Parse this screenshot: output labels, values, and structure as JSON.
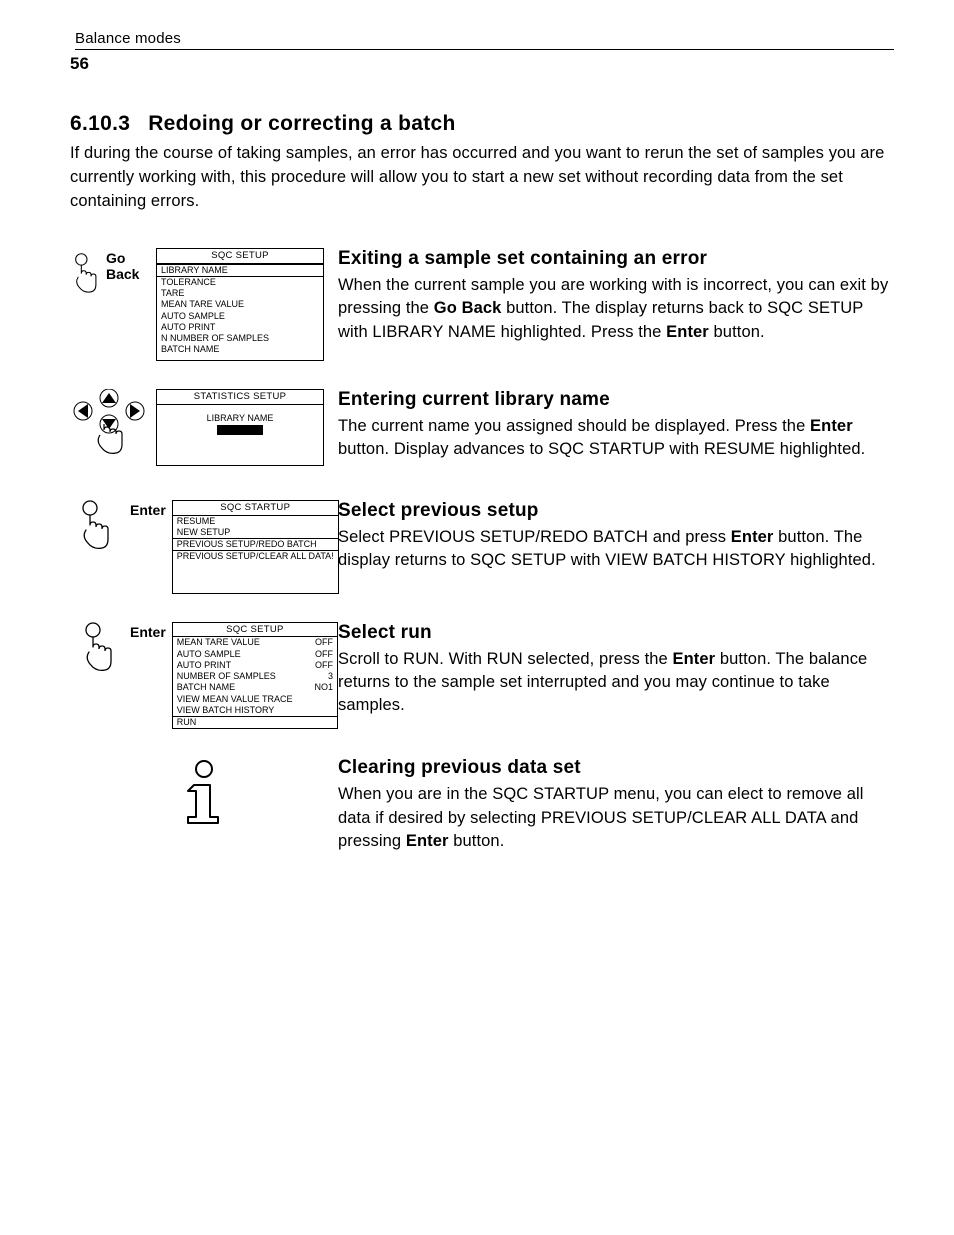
{
  "header": {
    "running": "Balance modes",
    "page_num": "56"
  },
  "section": {
    "number": "6.10.3",
    "title": "Redoing or correcting a batch",
    "intro": "If during the course of taking samples, an error has occurred and you want to rerun the set of samples you are currently working with, this procedure will allow you to start a new set without recording data from the set containing errors."
  },
  "steps": {
    "s1": {
      "button": "Go Back",
      "lcd_title": "SQC SETUP",
      "lcd_items": [
        "LIBRARY NAME",
        "TOLERANCE",
        "TARE",
        "MEAN TARE VALUE",
        "AUTO SAMPLE",
        "AUTO PRINT",
        "N NUMBER OF SAMPLES",
        "BATCH NAME"
      ],
      "heading": "Exiting a sample set containing an error",
      "body_a": "When the current sample you are working with is incorrect, you can exit by pressing the ",
      "body_b": " button. The display returns back to SQC SETUP with LIBRARY NAME highlighted. Press the ",
      "body_c": " button.",
      "bold1": "Go Back",
      "bold2": "Enter"
    },
    "s2": {
      "lcd_title": "STATISTICS SETUP",
      "lcd_field": "LIBRARY NAME",
      "heading": "Entering current library name",
      "body_a": "The current name you assigned should be displayed. Press the ",
      "body_b": " button. Display advances to SQC STARTUP with RESUME highlighted.",
      "bold1": "Enter"
    },
    "s3": {
      "button": "Enter",
      "lcd_title": "SQC STARTUP",
      "lcd_items": [
        "RESUME",
        "NEW SETUP",
        "PREVIOUS SETUP/REDO BATCH",
        "PREVIOUS SETUP/CLEAR ALL DATA!"
      ],
      "heading": "Select previous setup",
      "body_a": "Select PREVIOUS SETUP/REDO BATCH and press ",
      "body_b": " button. The display returns to SQC SETUP with VIEW BATCH HISTORY highlighted.",
      "bold1": "Enter"
    },
    "s4": {
      "button": "Enter",
      "lcd_title": "SQC SETUP",
      "lcd_rows": [
        {
          "k": "MEAN TARE VALUE",
          "v": "OFF"
        },
        {
          "k": "AUTO SAMPLE",
          "v": "OFF"
        },
        {
          "k": "AUTO PRINT",
          "v": "OFF"
        },
        {
          "k": "NUMBER OF SAMPLES",
          "v": "3"
        },
        {
          "k": "BATCH NAME",
          "v": "NO1"
        },
        {
          "k": "VIEW MEAN VALUE TRACE",
          "v": ""
        },
        {
          "k": "VIEW BATCH HISTORY",
          "v": ""
        },
        {
          "k": "RUN",
          "v": ""
        }
      ],
      "heading": "Select run",
      "body_a": "Scroll to RUN. With RUN selected, press the ",
      "body_b": " button. The balance returns to the sample set interrupted and you may continue to take samples.",
      "bold1": "Enter"
    },
    "s5": {
      "heading": "Clearing previous data set",
      "body_a": "When you are in the SQC STARTUP menu, you can elect to remove all data if desired by selecting PREVIOUS SETUP/CLEAR ALL DATA and pressing ",
      "body_b": " button.",
      "bold1": "Enter"
    }
  }
}
